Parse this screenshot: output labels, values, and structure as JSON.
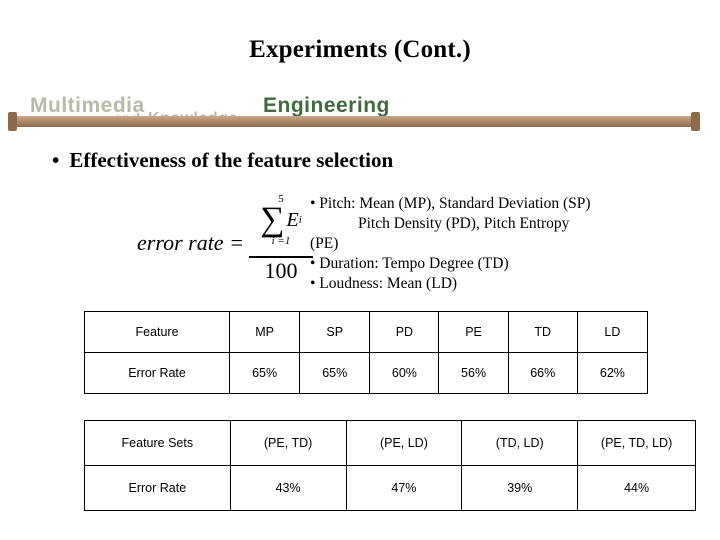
{
  "slide": {
    "title": "Experiments (Cont.)",
    "banner": {
      "word1": "Multimedia",
      "word2": "and",
      "word3": "Knowledge",
      "word4": "Engineering"
    },
    "bullet": {
      "marker": "•",
      "text": "Effectiveness of the feature selection"
    },
    "formula": {
      "lhs": "error rate =",
      "sigma_top": "5",
      "sigma_symbol": "∑",
      "sigma_term": "E",
      "sigma_term_sub": "i",
      "sigma_bottom": "i =1",
      "denominator": "100"
    },
    "description": {
      "line1": "• Pitch: Mean (MP), Standard Deviation (SP)",
      "line2": "Pitch Density (PD), Pitch Entropy",
      "line3": "(PE)",
      "line4": "• Duration: Tempo Degree (TD)",
      "line5": "• Loudness: Mean (LD)"
    },
    "table_features": {
      "header": [
        "Feature",
        "MP",
        "SP",
        "PD",
        "PE",
        "TD",
        "LD"
      ],
      "row": [
        "Error Rate",
        "65%",
        "65%",
        "60%",
        "56%",
        "66%",
        "62%"
      ]
    },
    "table_feature_sets": {
      "header": [
        "Feature Sets",
        "(PE, TD)",
        "(PE, LD)",
        "(TD, LD)",
        "(PE, TD, LD)"
      ],
      "row": [
        "Error Rate",
        "43%",
        "47%",
        "39%",
        "44%"
      ]
    }
  }
}
